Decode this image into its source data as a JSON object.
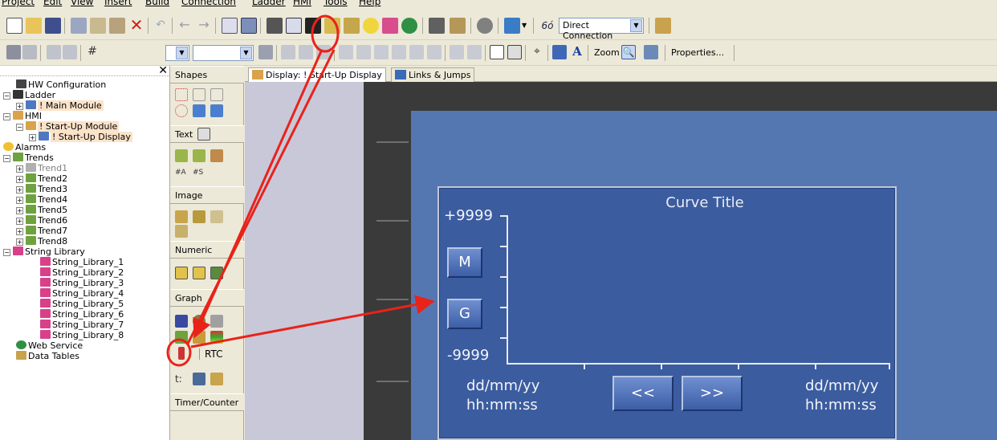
{
  "menu": [
    "Project",
    "Edit",
    "View",
    "Insert",
    "Build",
    "Connection",
    "Ladder",
    "HMI",
    "Tools",
    "Help"
  ],
  "toolbar": {
    "connection_value": "Direct Connection",
    "zoom_label": "Zoom",
    "properties_label": "Properties..."
  },
  "tree": {
    "items": [
      {
        "label": "HW Configuration"
      },
      {
        "label": "Ladder"
      },
      {
        "label": "! Main Module"
      },
      {
        "label": "HMI"
      },
      {
        "label": "! Start-Up Module"
      },
      {
        "label": "! Start-Up Display"
      },
      {
        "label": "Alarms"
      },
      {
        "label": "Trends"
      },
      {
        "label": "Trend1"
      },
      {
        "label": "Trend2"
      },
      {
        "label": "Trend3"
      },
      {
        "label": "Trend4"
      },
      {
        "label": "Trend5"
      },
      {
        "label": "Trend6"
      },
      {
        "label": "Trend7"
      },
      {
        "label": "Trend8"
      },
      {
        "label": "String Library"
      },
      {
        "label": "String_Library_1"
      },
      {
        "label": "String_Library_2"
      },
      {
        "label": "String_Library_3"
      },
      {
        "label": "String_Library_4"
      },
      {
        "label": "String_Library_5"
      },
      {
        "label": "String_Library_6"
      },
      {
        "label": "String_Library_7"
      },
      {
        "label": "String_Library_8"
      },
      {
        "label": "Web Service"
      },
      {
        "label": "Data Tables"
      }
    ]
  },
  "palette": {
    "sections": [
      "Shapes",
      "Text",
      "Image",
      "Numeric",
      "Graph",
      "Timer/Counter"
    ],
    "rtc_label": "RTC",
    "small_labels": [
      "#A",
      "#S"
    ]
  },
  "tabs": [
    {
      "label": "Display: ! Start-Up Display"
    },
    {
      "label": "Links & Jumps"
    }
  ],
  "trend": {
    "title": "Curve Title",
    "y_max": "+9999",
    "y_min": "-9999",
    "btn_m": "M",
    "btn_g": "G",
    "date_left": "dd/mm/yy",
    "time_left": "hh:mm:ss",
    "date_right": "dd/mm/yy",
    "time_right": "hh:mm:ss",
    "btn_prev": "<<",
    "btn_next": ">>"
  },
  "colors": {
    "annotation": "#e8231a",
    "screen_bg": "#5577b1",
    "trend_bg": "#3b5c9f"
  }
}
